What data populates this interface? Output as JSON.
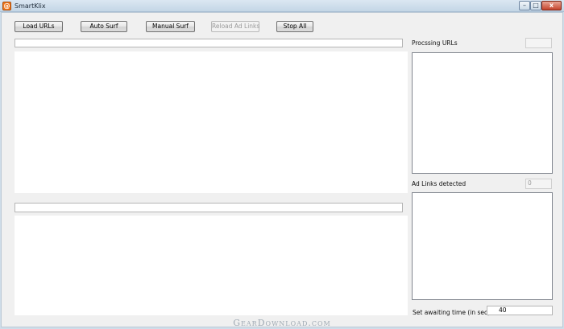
{
  "window": {
    "title": "SmartKlix",
    "icon": "smartklix-app-icon",
    "controls": {
      "minimize": "–",
      "maximize": "□",
      "close": "x"
    }
  },
  "toolbar": {
    "load_urls": "Load URLs",
    "auto_surf": "Auto Surf",
    "manual_surf": "Manual Surf",
    "reload_ad_links": "Reload Ad Links",
    "stop_all": "Stop All"
  },
  "right_panel": {
    "processing_urls_label": "Procssing URLs",
    "processing_urls_value": "",
    "ad_links_label": "Ad Links detected",
    "ad_links_value": "0",
    "awaiting_time_label": "Set awaiting time (in sec)",
    "awaiting_time_value": "40"
  },
  "footer": {
    "watermark": "GearDownload.com"
  }
}
